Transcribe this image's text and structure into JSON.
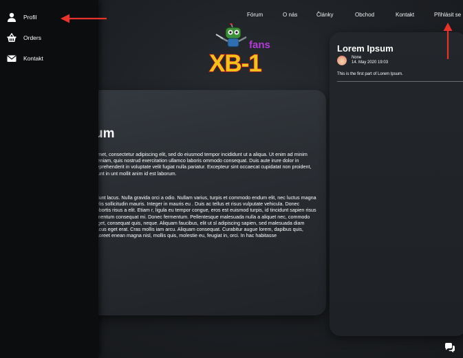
{
  "nav": {
    "items": [
      "Fórum",
      "O nás",
      "Články",
      "Obchod",
      "Kontakt"
    ],
    "login": "Přihlásit se"
  },
  "logo": {
    "text_top": "fans",
    "text_main": "XB-1"
  },
  "sidebar": {
    "items": [
      {
        "label": "Profil",
        "icon": "user-icon"
      },
      {
        "label": "Orders",
        "icon": "basket-icon"
      },
      {
        "label": "Kontakt",
        "icon": "envelope-icon"
      }
    ]
  },
  "article": {
    "title": "um",
    "paragraph_1": "amet, consectetur adipiscing elit, sed do eiusmod tempor incididunt ut a aliqua. Ut enim ad minim veniam, quis nostrud exercitation ullamco laboris ommodo consequat. Duis aute irure dolor in reprehenderit in voluptate velit fugiat nulla pariatur. Excepteur sint occaecat cupidatat non proident, sunt in unt mollit anim id est laborum.",
    "paragraph_2": "idunt lacus. Nulla gravida orci a odio. Nullam varius, turpis et commodo endum elit, nec luctus magna felis sollicitudin mauris. Integer in mauris eu . Duis ac tellus et risus vulputate vehicula. Donec lobortis risus a elit. Etiam r, ligula eu tempor congue, eros est euismod turpis, id tincidunt sapien risus rmentum consequat mi. Donec fermentum. Pellentesque malesuada nulla a aliquet nec, commodo eget, consequat quis, neque. Aliquam faucibus, elit ut sl adipiscing sapien, sed malesuada diam lacus eget erat. Cras mollis iam arcu. Aliquam consequat. Curabitur augue lorem, dapibus quis, laoreet enean magna nisl, mollis quis, molestie eu, feugiat in, orci. In hac habitasse"
  },
  "card": {
    "title": "Lorem Ipsum",
    "author": "None",
    "date": "14. May 2020 19:03",
    "excerpt": "This is the first part of Lorem Ipsum."
  },
  "colors": {
    "background": "#1b1d21",
    "sidebar": "#0c0d0f",
    "annotation_arrow": "#e8322a",
    "logo_yellow": "#f2c21a",
    "logo_purple": "#b23bd6"
  },
  "icons": {
    "chat": "chat-bubbles-icon"
  }
}
